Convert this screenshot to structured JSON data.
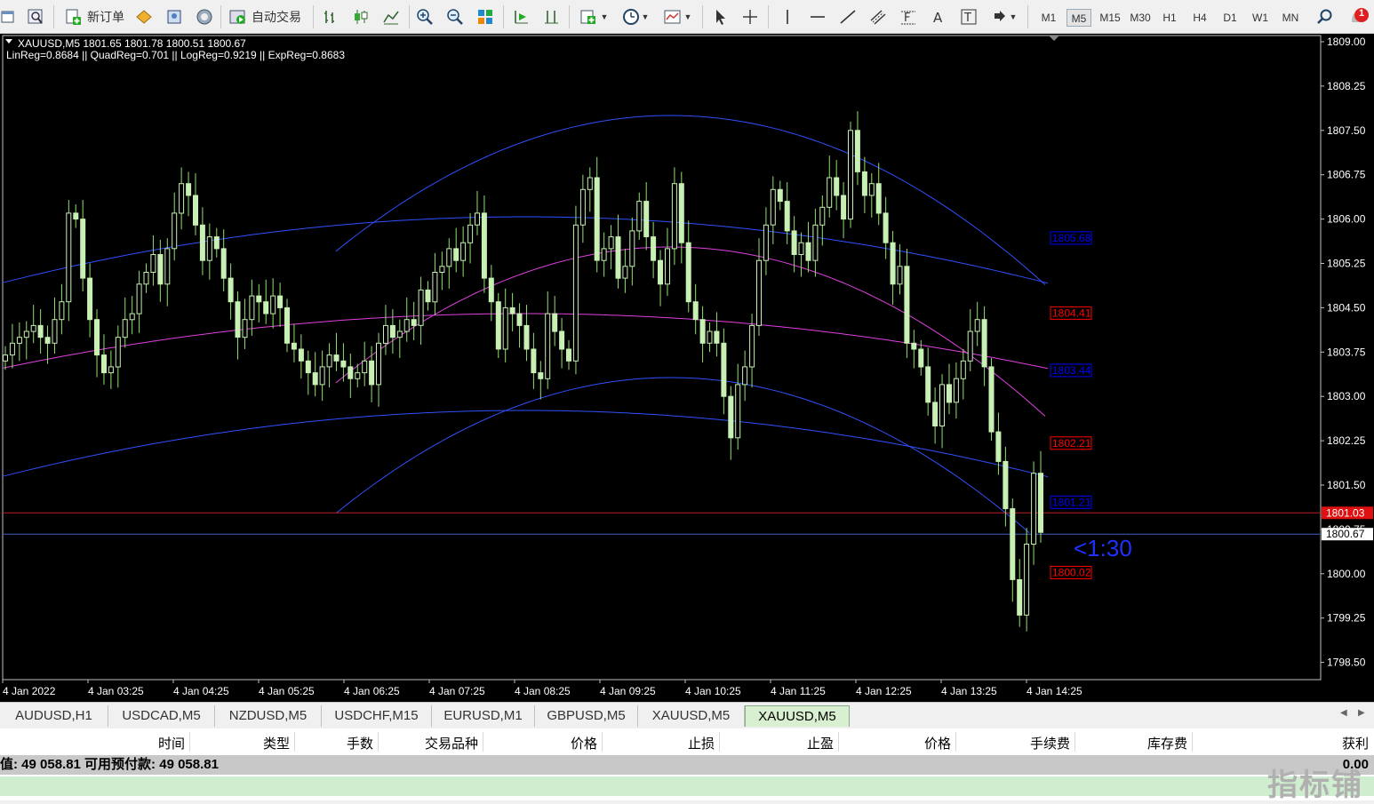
{
  "toolbar": {
    "new_order_label": "新订单",
    "autotrade_label": "自动交易",
    "timeframes": [
      "M1",
      "M5",
      "M15",
      "M30",
      "H1",
      "H4",
      "D1",
      "W1",
      "MN"
    ],
    "active_timeframe": "M5",
    "alert_count": "1"
  },
  "chart": {
    "header": "XAUUSD,M5  1801.65 1801.78 1800.51 1800.67",
    "indicator_text": "LinReg=0.8684 || QuadReg=0.701 || LogReg=0.9219 || ExpReg=0.8683",
    "countdown": "<1:30",
    "current_price": "1800.67",
    "red_price": "1801.03",
    "price_axis": [
      "1809.00",
      "1808.25",
      "1807.50",
      "1806.75",
      "1806.00",
      "1805.25",
      "1804.50",
      "1803.75",
      "1803.00",
      "1802.25",
      "1801.50",
      "1800.75",
      "1800.00",
      "1799.25",
      "1798.50"
    ],
    "time_axis": [
      "4 Jan 2022",
      "4 Jan 03:25",
      "4 Jan 04:25",
      "4 Jan 05:25",
      "4 Jan 06:25",
      "4 Jan 07:25",
      "4 Jan 08:25",
      "4 Jan 09:25",
      "4 Jan 10:25",
      "4 Jan 11:25",
      "4 Jan 12:25",
      "4 Jan 13:25",
      "4 Jan 14:25"
    ],
    "level_labels": [
      {
        "text": "1805.68",
        "color": "#0000ff"
      },
      {
        "text": "1804.41",
        "color": "#ff0000"
      },
      {
        "text": "1803.44",
        "color": "#0000ff"
      },
      {
        "text": "1802.21",
        "color": "#ff0000"
      },
      {
        "text": "1801.21",
        "color": "#0000ff"
      },
      {
        "text": "1800.02",
        "color": "#ff0000"
      }
    ],
    "colors": {
      "candle": "#c8f0b4",
      "wick": "#90e070",
      "reg_blue": "#3050ff",
      "reg_magenta": "#e040e0",
      "bid_line": "#4060c0",
      "red_line": "#c02020"
    }
  },
  "chart_tabs": [
    "AUDUSD,H1",
    "USDCAD,M5",
    "NZDUSD,M5",
    "USDCHF,M15",
    "EURUSD,M1",
    "GBPUSD,M5",
    "XAUUSD,M5",
    "XAUUSD,M5"
  ],
  "active_tab_index": 7,
  "terminal": {
    "columns": [
      "时间",
      "类型",
      "手数",
      "交易品种",
      "价格",
      "止损",
      "止盈",
      "价格",
      "手续费",
      "库存费",
      "获利"
    ],
    "balance_text": "值: 49 058.81  可用预付款: 49 058.81",
    "profit_value": "0.00",
    "watermark": "指标铺"
  }
}
